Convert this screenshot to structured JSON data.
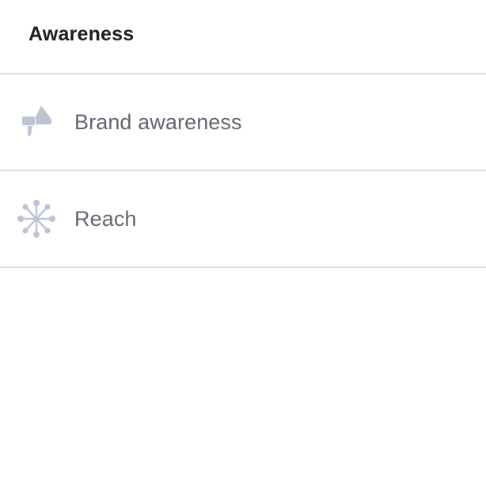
{
  "section": {
    "title": "Awareness"
  },
  "options": [
    {
      "label": "Brand awareness",
      "icon": "megaphone-icon"
    },
    {
      "label": "Reach",
      "icon": "network-icon"
    }
  ],
  "colors": {
    "icon": "#bec3d3",
    "divider": "#dadde1",
    "title": "#1c1e21",
    "label": "#606770"
  }
}
